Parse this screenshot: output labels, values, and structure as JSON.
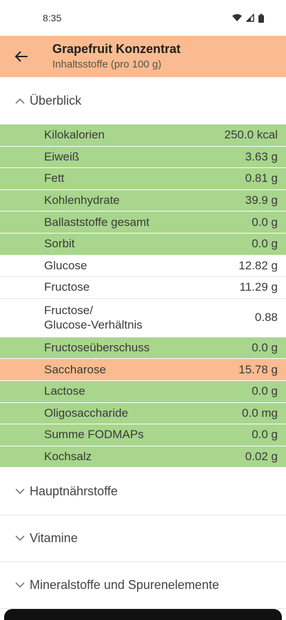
{
  "status_bar": {
    "time": "8:35"
  },
  "app_bar": {
    "title": "Grapefruit Konzentrat",
    "subtitle": "Inhaltsstoffe (pro 100 g)"
  },
  "sections": {
    "overview": "Überblick",
    "main_nutrients": "Hauptnährstoffe",
    "vitamins": "Vitamine",
    "minerals": "Mineralstoffe und Spurenelemente"
  },
  "colors": {
    "good": "#a8d68c",
    "warn": "#f9bb8f",
    "neutral": "#ffffff"
  },
  "rows": [
    {
      "name": "Kilokalorien",
      "value": "250.0 kcal",
      "status": "good"
    },
    {
      "name": "Eiweiß",
      "value": "3.63 g",
      "status": "good"
    },
    {
      "name": "Fett",
      "value": "0.81 g",
      "status": "good"
    },
    {
      "name": "Kohlenhydrate",
      "value": "39.9 g",
      "status": "good"
    },
    {
      "name": "Ballaststoffe gesamt",
      "value": "0.0 g",
      "status": "good"
    },
    {
      "name": "Sorbit",
      "value": "0.0 g",
      "status": "good"
    },
    {
      "name": "Glucose",
      "value": "12.82 g",
      "status": "neutral"
    },
    {
      "name": "Fructose",
      "value": "11.29 g",
      "status": "neutral"
    },
    {
      "name": "Fructose/\nGlucose-Verhältnis",
      "value": "0.88",
      "status": "neutral"
    },
    {
      "name": "Fructoseüberschuss",
      "value": "0.0 g",
      "status": "good"
    },
    {
      "name": "Saccharose",
      "value": "15.78 g",
      "status": "warn"
    },
    {
      "name": "Lactose",
      "value": "0.0 g",
      "status": "good"
    },
    {
      "name": "Oligosaccharide",
      "value": "0.0 mg",
      "status": "good"
    },
    {
      "name": "Summe FODMAPs",
      "value": "0.0 g",
      "status": "good"
    },
    {
      "name": "Kochsalz",
      "value": "0.02 g",
      "status": "good"
    }
  ]
}
